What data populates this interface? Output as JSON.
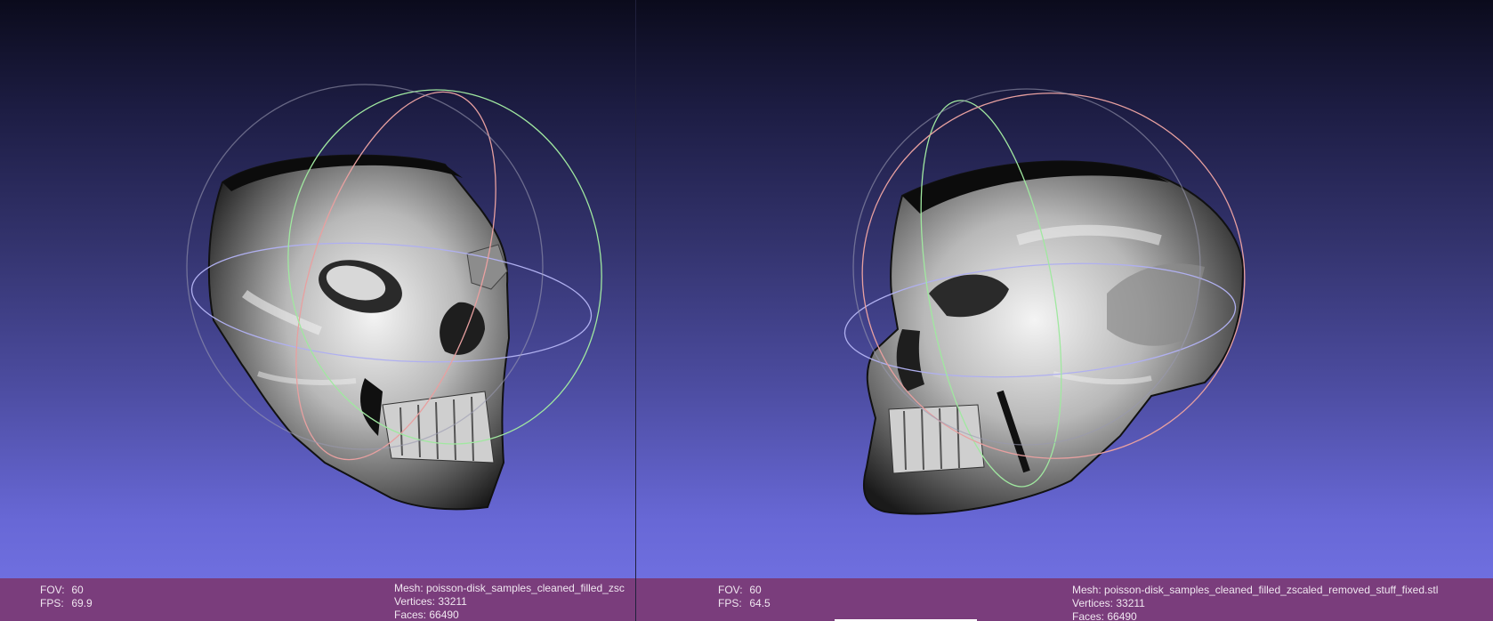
{
  "app": {
    "name": "MeshLab split view"
  },
  "colors": {
    "background_top": "#0b0b1c",
    "background_bottom": "#7474e6",
    "info_bar": "#7a3d7c",
    "trackball_x": "#e8a0a0",
    "trackball_y": "#a0e8a0",
    "trackball_z": "#b0b0f0",
    "trackball_ghost": "#9a9ab0"
  },
  "views": [
    {
      "fov_label": "FOV:",
      "fov_value": "60",
      "fps_label": "FPS:",
      "fps_value": "69.9",
      "mesh_label": "Mesh:",
      "mesh_name": "poisson-disk_samples_cleaned_filled_zsc",
      "vertices_label": "Vertices:",
      "vertices_value": "33211",
      "faces_label": "Faces:",
      "faces_value": "66490"
    },
    {
      "fov_label": "FOV:",
      "fov_value": "60",
      "fps_label": "FPS:",
      "fps_value": "64.5",
      "mesh_label": "Mesh:",
      "mesh_name": "poisson-disk_samples_cleaned_filled_zscaled_removed_stuff_fixed.stl",
      "vertices_label": "Vertices:",
      "vertices_value": "33211",
      "faces_label": "Faces:",
      "faces_value": "66490"
    }
  ]
}
